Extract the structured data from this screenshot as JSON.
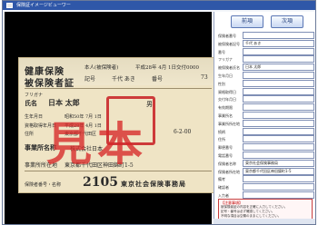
{
  "window": {
    "title": "保険証イメージビューワー"
  },
  "toolbar": {
    "prev_label": "前項",
    "next_label": "次項"
  },
  "card": {
    "insurance_type": "健康保険",
    "cert_type": "被保険者証",
    "person_type": "本人(被保険者)",
    "issued": "平成28年 4月 1日交付0000",
    "symbol_label": "記号",
    "symbol_value": "千代 あき",
    "number_label": "番号",
    "number_value": "73",
    "kana_label": "フリガナ",
    "name_label": "氏名",
    "name_value": "日本 太郎",
    "sex": "男",
    "dob_label": "生年月日",
    "dob_value": "昭和50年 7月 1日",
    "qualification_label": "資格取得年月日",
    "qualification_value": "平成28年 4月 1日",
    "address_label": "住所",
    "address_value": "東京都千代田区",
    "code": "6-2-00",
    "employer_label": "事業所名称",
    "employer_name": "株式会社日本",
    "location_label": "事業所所在地",
    "location_value": "東京都千代田区神田錦町1-5",
    "insurer_label": "保険者番号・名称",
    "insurer_number": "2105",
    "insurer_name": "東京社会保険事務局",
    "watermark": "見本"
  },
  "form": {
    "fields": [
      {
        "label": "保険者番号",
        "value": ""
      },
      {
        "label": "被保険者記号",
        "value": "千代 あき"
      },
      {
        "label": "番号",
        "value": ""
      },
      {
        "label": "フリガナ",
        "value": ""
      },
      {
        "label": "被保険者氏名",
        "value": "日本 太郎"
      },
      {
        "label": "生年月日",
        "value": ""
      },
      {
        "label": "性別",
        "value": ""
      },
      {
        "label": "資格取得日",
        "value": ""
      },
      {
        "label": "交付年月日",
        "value": ""
      },
      {
        "label": "有効期限",
        "value": ""
      },
      {
        "label": "事業所名",
        "value": ""
      },
      {
        "label": "事業所所在地",
        "value": ""
      },
      {
        "label": "続柄",
        "value": ""
      },
      {
        "label": "住所",
        "value": ""
      },
      {
        "label": "郵便番号",
        "value": ""
      },
      {
        "label": "電話番号",
        "value": ""
      },
      {
        "label": "保険者名称",
        "value": "東京社会保険事務局"
      },
      {
        "label": "保険者所在地",
        "value": "東京都千代田区神田錦町1-5"
      },
      {
        "label": "備考",
        "value": ""
      },
      {
        "label": "確認者",
        "value": ""
      },
      {
        "label": "入力者",
        "value": ""
      }
    ]
  },
  "note": {
    "title": "【注意事項】",
    "lines": [
      "被保険者証の内容を正確に入力してください。",
      "記号・番号は必ず確認してください。",
      "不明な項目は空欄のままにしてください。"
    ]
  },
  "colors": {
    "title_bar": "#2f57a8",
    "stamp_red": "#cd3a3a",
    "card_bg": "#efe4c5"
  }
}
